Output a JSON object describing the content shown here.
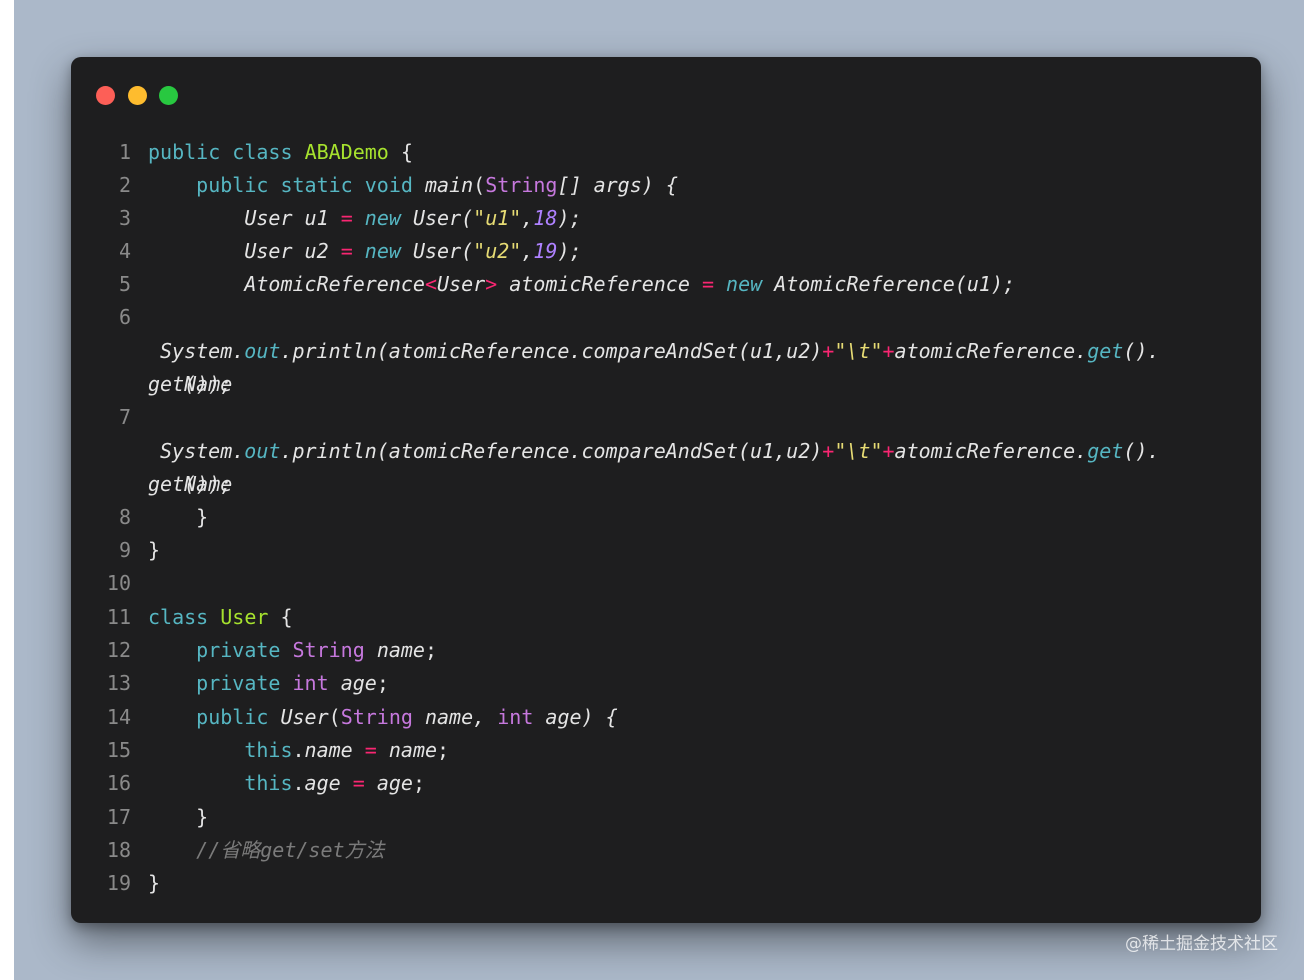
{
  "window": {
    "traffic_lights": {
      "close_color": "#fd5f57",
      "minimize_color": "#febc2e",
      "maximize_color": "#28c840"
    }
  },
  "code": {
    "lines": [
      {
        "n": "1"
      },
      {
        "n": "2"
      },
      {
        "n": "3"
      },
      {
        "n": "4"
      },
      {
        "n": "5"
      },
      {
        "n": "6"
      },
      {
        "n": "7"
      },
      {
        "n": "8"
      },
      {
        "n": "9"
      },
      {
        "n": "10"
      },
      {
        "n": "11"
      },
      {
        "n": "12"
      },
      {
        "n": "13"
      },
      {
        "n": "14"
      },
      {
        "n": "15"
      },
      {
        "n": "16"
      },
      {
        "n": "17"
      },
      {
        "n": "18"
      },
      {
        "n": "19"
      }
    ],
    "tokens": {
      "public": "public",
      "class": "class",
      "ABADemo": "ABADemo",
      "brace_open": "{",
      "brace_close": "}",
      "static": "static",
      "void": "void",
      "main": "main",
      "String": "String",
      "args_sig": "[] args) {",
      "paren_open": "(",
      "User": "User",
      "u1": "u1",
      "u2": "u2",
      "eq": "=",
      "new": "new",
      "str_u1": "\"u1\"",
      "str_u2": "\"u2\"",
      "n18": "18",
      "n19": "19",
      "comma": ",",
      "close_semi": ");",
      "AtomicReference": "AtomicReference",
      "lt": "<",
      "gt": ">",
      "atomicReference": "atomicReference",
      "atomic_ctor_arg": "(u1);",
      "System": "System",
      "dot": ".",
      "out": "out",
      "println_cas": "println(atomicReference.compareAndSet(u1,u2)",
      "plus": "+",
      "tab_str": "\"\\t\"",
      "get": "get",
      "parens_dot": "().",
      "getName_overlap": "getName",
      "close_overlap": "());",
      "private": "private",
      "int": "int",
      "name": "name",
      "age": "age",
      "semi": ";",
      "ctor_sig_a": "(",
      "ctor_sig_b": " name, ",
      "ctor_sig_c": " age) {",
      "this": "this",
      "comment": "//省略get/set方法"
    }
  },
  "watermark": "@稀土掘金技术社区"
}
